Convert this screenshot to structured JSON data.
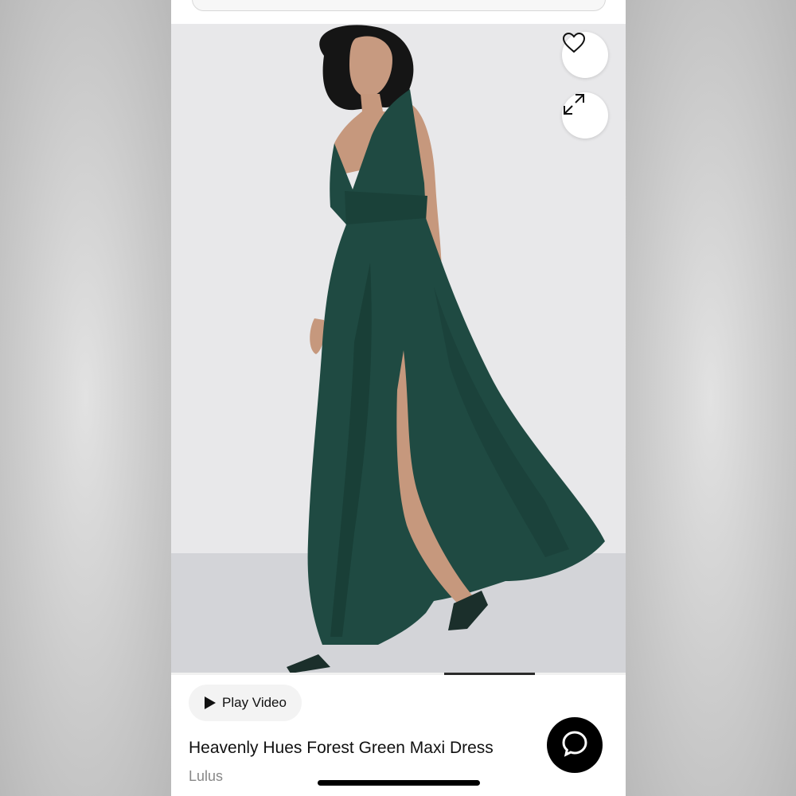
{
  "product": {
    "title": "Heavenly Hues Forest Green Maxi Dress",
    "brand": "Lulus"
  },
  "media": {
    "play_video_label": "Play Video",
    "gallery_progress": 0.2
  },
  "icons": {
    "favorite": "heart-icon",
    "expand": "expand-icon",
    "play": "play-icon",
    "chat": "chat-bubble-icon"
  },
  "colors": {
    "dress": "#1f4a42",
    "accent": "#000000",
    "brand_text": "#888888"
  }
}
